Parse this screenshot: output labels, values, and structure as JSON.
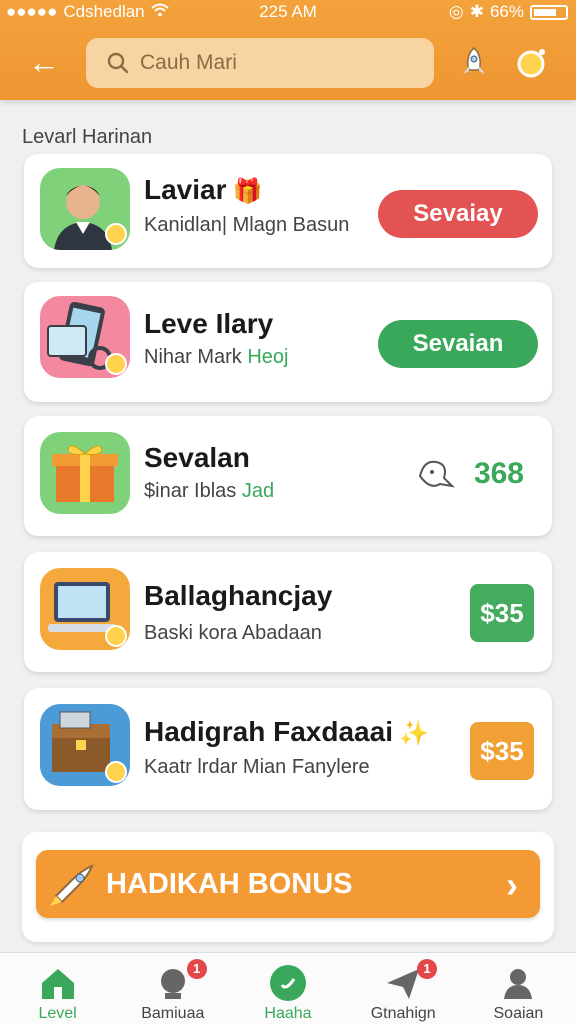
{
  "status_bar": {
    "carrier": "Cdshedlan",
    "time": "225 AM",
    "battery": "66%"
  },
  "header": {
    "search_placeholder": "Cauh Mari"
  },
  "section": {
    "title": "Levarl Harinan"
  },
  "items": [
    {
      "title": "Laviar",
      "subtitle": "Kanidlan| Mlagn Basun",
      "action": "Sevaiay",
      "action_color": "#e35353"
    },
    {
      "title": "Leve Ilary",
      "subtitle_main": "Nihar Mark",
      "subtitle_accent": "Heoj",
      "action": "Sevaian",
      "action_color": "#3aa85a"
    },
    {
      "title": "Sevalan",
      "subtitle_main": "$inar Iblas",
      "subtitle_accent": "Jad",
      "points": "368"
    },
    {
      "title": "Ballaghancjay",
      "subtitle": "Baski kora Abadaan",
      "price": "$35",
      "price_color": "#44ab5f"
    },
    {
      "title": "Hadigrah Faxdaaai",
      "subtitle": "Kaatr lrdar Mian Fanylere",
      "price": "$35",
      "price_color": "#f1a035"
    }
  ],
  "bonus": {
    "label": "HADIKAH BONUS"
  },
  "tabs": [
    {
      "label": "Level",
      "icon": "home-icon"
    },
    {
      "label": "Bamiuaa",
      "icon": "trophy-icon",
      "badge": "1"
    },
    {
      "label": "Haaha",
      "icon": "gift-icon"
    },
    {
      "label": "Gtnahign",
      "icon": "send-icon",
      "badge": "1"
    },
    {
      "label": "Soaian",
      "icon": "profile-icon"
    }
  ]
}
